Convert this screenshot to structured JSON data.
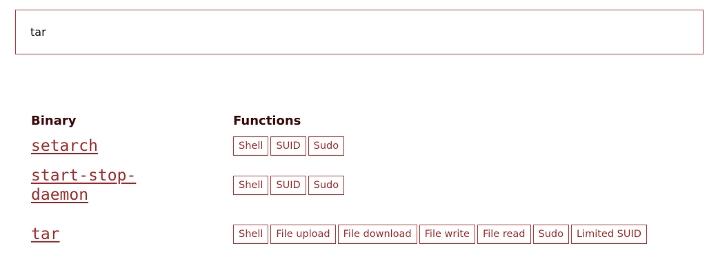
{
  "search": {
    "value": "tar"
  },
  "table": {
    "headers": {
      "binary": "Binary",
      "functions": "Functions"
    },
    "rows": [
      {
        "binary": "setarch",
        "functions": [
          "Shell",
          "SUID",
          "Sudo"
        ]
      },
      {
        "binary": "start-stop-daemon",
        "functions": [
          "Shell",
          "SUID",
          "Sudo"
        ]
      },
      {
        "binary": "tar",
        "functions": [
          "Shell",
          "File upload",
          "File download",
          "File write",
          "File read",
          "Sudo",
          "Limited SUID"
        ]
      }
    ]
  },
  "colors": {
    "accent": "#a12d2d",
    "border": "#b03a3a",
    "heading": "#3d0b0b"
  }
}
